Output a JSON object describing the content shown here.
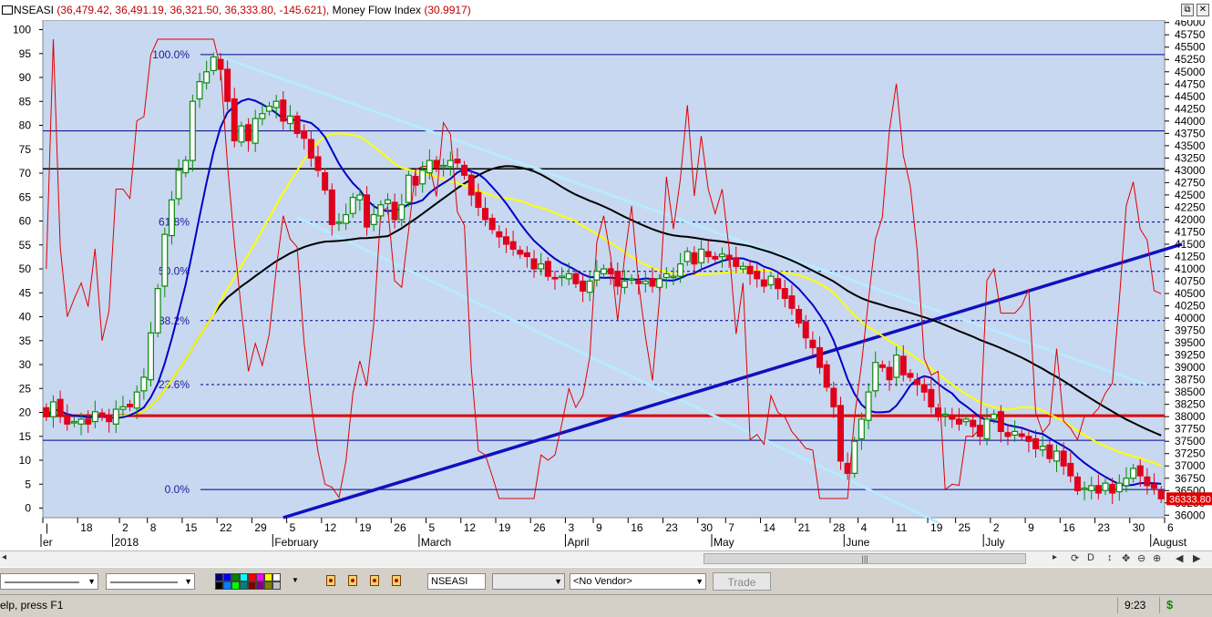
{
  "window": {
    "symbol": "NSEASI",
    "ohlc": "(36,479.42, 36,491.19, 36,321.50, 36,333.80, -145.621),",
    "indicator": "Money Flow Index",
    "indicator_value": "(30.9917)",
    "restore_glyph": "⧉",
    "close_glyph": "✕"
  },
  "colors": {
    "background": "#c8d8f0",
    "up": "#0a8a0a",
    "down": "#e0001a",
    "mfi": "#e00000",
    "ma_fast": "#0000c8",
    "ma_mid": "#ffff00",
    "ma_slow": "#000000",
    "trend": "#1010c0",
    "channel": "#b8eaff"
  },
  "chart_data": {
    "type": "candlestick",
    "price_axis": {
      "ticks": [
        "46000",
        "45750",
        "45500",
        "45250",
        "45000",
        "44750",
        "44500",
        "44250",
        "44000",
        "43750",
        "43500",
        "43250",
        "43000",
        "42750",
        "42500",
        "42250",
        "42000",
        "41750",
        "41500",
        "41250",
        "41000",
        "40750",
        "40500",
        "40250",
        "40000",
        "39750",
        "39500",
        "39250",
        "39000",
        "38750",
        "38500",
        "38250",
        "38000",
        "37750",
        "37500",
        "37250",
        "37000",
        "36750",
        "36500",
        "36250",
        "36000"
      ],
      "range": [
        35950,
        46050
      ]
    },
    "mfi_axis": {
      "ticks": [
        "100",
        "95",
        "90",
        "85",
        "80",
        "75",
        "70",
        "65",
        "60",
        "55",
        "50",
        "45",
        "40",
        "35",
        "30",
        "25",
        "20",
        "15",
        "10",
        "5",
        "0"
      ],
      "range": [
        -2,
        102
      ]
    },
    "last_price_label": "36333.80",
    "x_ticks": [
      {
        "label": "|",
        "bar": 0
      },
      {
        "label": "18",
        "bar": 5
      },
      {
        "label": "2",
        "bar": 11
      },
      {
        "label": "8",
        "bar": 15
      },
      {
        "label": "15",
        "bar": 20
      },
      {
        "label": "22",
        "bar": 25
      },
      {
        "label": "29",
        "bar": 30
      },
      {
        "label": "5",
        "bar": 35
      },
      {
        "label": "12",
        "bar": 40
      },
      {
        "label": "19",
        "bar": 45
      },
      {
        "label": "26",
        "bar": 50
      },
      {
        "label": "5",
        "bar": 55
      },
      {
        "label": "12",
        "bar": 60
      },
      {
        "label": "19",
        "bar": 65
      },
      {
        "label": "26",
        "bar": 70
      },
      {
        "label": "3",
        "bar": 75
      },
      {
        "label": "9",
        "bar": 79
      },
      {
        "label": "16",
        "bar": 84
      },
      {
        "label": "23",
        "bar": 89
      },
      {
        "label": "30",
        "bar": 94
      },
      {
        "label": "7",
        "bar": 98
      },
      {
        "label": "14",
        "bar": 103
      },
      {
        "label": "21",
        "bar": 108
      },
      {
        "label": "28",
        "bar": 113
      },
      {
        "label": "4",
        "bar": 117
      },
      {
        "label": "11",
        "bar": 122
      },
      {
        "label": "19",
        "bar": 127
      },
      {
        "label": "25",
        "bar": 131
      },
      {
        "label": "2",
        "bar": 136
      },
      {
        "label": "9",
        "bar": 141
      },
      {
        "label": "16",
        "bar": 146
      },
      {
        "label": "23",
        "bar": 151
      },
      {
        "label": "30",
        "bar": 156
      },
      {
        "label": "6",
        "bar": 161
      }
    ],
    "month_labels": [
      {
        "label": "er",
        "bar": 0
      },
      {
        "label": "2018",
        "bar": 10
      },
      {
        "label": "February",
        "bar": 33
      },
      {
        "label": "March",
        "bar": 54
      },
      {
        "label": "April",
        "bar": 75
      },
      {
        "label": "May",
        "bar": 96
      },
      {
        "label": "June",
        "bar": 115
      },
      {
        "label": "July",
        "bar": 135
      },
      {
        "label": "August",
        "bar": 159
      }
    ],
    "fib_levels": [
      {
        "label": "100.0%",
        "price": 45350
      },
      {
        "label": "61.8%",
        "price": 41950
      },
      {
        "label": "50.0%",
        "price": 40950
      },
      {
        "label": "38.2%",
        "price": 39950
      },
      {
        "label": "23.6%",
        "price": 38650
      },
      {
        "label": "0.0%",
        "price": 36520
      }
    ],
    "extra_levels": [
      43800,
      37520
    ],
    "black_horizontal_price": 43030,
    "red_horizontal_price": 38020,
    "close": [
      38000,
      38300,
      38050,
      37850,
      37900,
      37950,
      37850,
      38100,
      38000,
      37900,
      38150,
      38200,
      38200,
      38500,
      38800,
      39700,
      40600,
      41700,
      42400,
      43000,
      43200,
      44400,
      44800,
      45000,
      45300,
      45050,
      44400,
      43600,
      43900,
      43600,
      44050,
      44150,
      44300,
      44400,
      44000,
      44100,
      43750,
      43650,
      43250,
      43000,
      42600,
      41900,
      41950,
      42100,
      42450,
      42500,
      41850,
      42100,
      42300,
      42400,
      42000,
      42300,
      42900,
      42700,
      43000,
      43200,
      43050,
      43100,
      43200,
      43150,
      42900,
      42500,
      42250,
      42000,
      41800,
      41650,
      41500,
      41400,
      41300,
      41250,
      41000,
      41100,
      40850,
      40800,
      40850,
      40900,
      40700,
      40550,
      40750,
      40950,
      41000,
      40900,
      40650,
      40750,
      40800,
      40700,
      40750,
      40650,
      40800,
      40900,
      40850,
      41100,
      41350,
      41100,
      41400,
      41250,
      41200,
      41300,
      41200,
      41050,
      41050,
      40900,
      40800,
      40650,
      40850,
      40600,
      40400,
      40200,
      39900,
      39600,
      39400,
      39000,
      38600,
      38200,
      37100,
      36850,
      37500,
      37950,
      38500,
      39100,
      39000,
      38750,
      39250,
      38850,
      38800,
      38650,
      38500,
      38200,
      38000,
      38050,
      37950,
      37850,
      37950,
      37800,
      37600,
      37950,
      38050,
      37700,
      37600,
      37700,
      37600,
      37500,
      37350,
      37400,
      37150,
      37300,
      37000,
      36800,
      36500,
      36550,
      36600,
      36450,
      36650,
      36450,
      36650,
      36750,
      36950,
      36800,
      36600,
      36550,
      36333.8
    ]
  },
  "scrollbar": {
    "thumb_grip": "|||"
  },
  "toolbar": {
    "symbol_value": "NSEASI",
    "vendor_value": "<No Vendor>",
    "trade_label": "Trade"
  },
  "status": {
    "help_text": "elp, press F1",
    "time": "9:23",
    "currency": "$"
  }
}
